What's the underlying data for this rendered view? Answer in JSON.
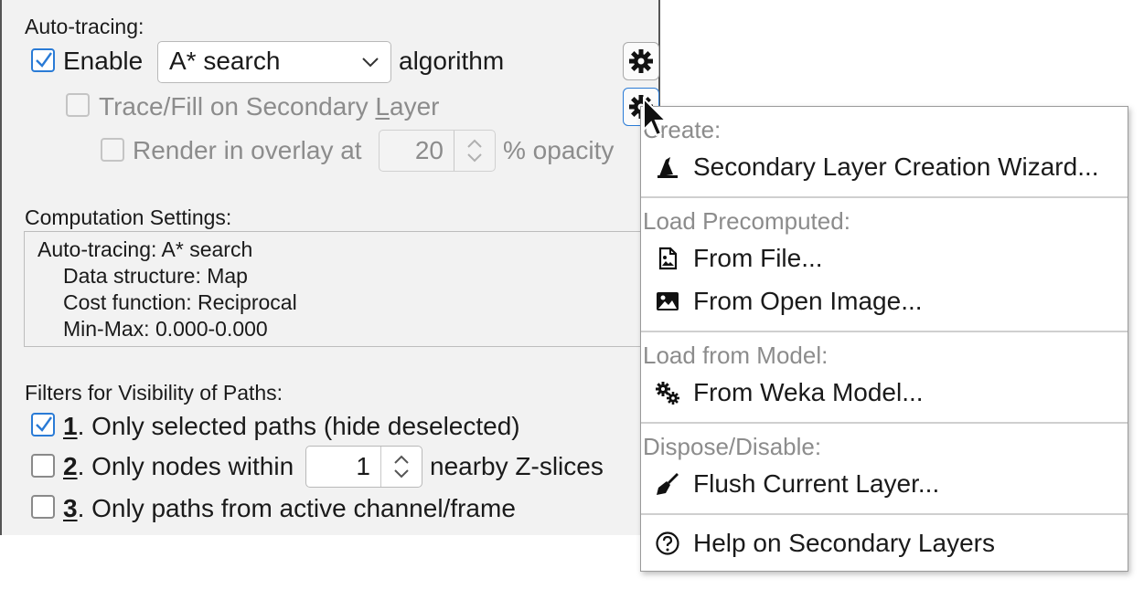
{
  "autotracing": {
    "title": "Auto-tracing:",
    "enable_label": "Enable",
    "enable_checked": true,
    "algorithm_value": "A* search",
    "algorithm_suffix": "algorithm",
    "secondary_layer_label_pre": "Trace/Fill on Secondary ",
    "secondary_layer_label_mnemonic": "L",
    "secondary_layer_label_post": "ayer",
    "secondary_layer_checked": false,
    "overlay_label": "Render in overlay at",
    "overlay_value": "20",
    "overlay_suffix": "% opacity",
    "overlay_checked": false
  },
  "computation": {
    "title": "Computation Settings:",
    "lines": [
      "Auto-tracing: A* search",
      "Data structure: Map",
      "Cost function: Reciprocal",
      "Min-Max: 0.000-0.000"
    ]
  },
  "filters": {
    "title": "Filters for Visibility of Paths:",
    "items": [
      {
        "num": "1",
        "text": ". Only selected paths (hide deselected)",
        "checked": true
      },
      {
        "num": "2",
        "text": ". Only nodes within",
        "value": "1",
        "suffix": "nearby Z-slices",
        "checked": false
      },
      {
        "num": "3",
        "text": ". Only paths from active channel/frame",
        "checked": false
      }
    ]
  },
  "menu": {
    "sections": [
      {
        "header": "Create:",
        "items": [
          {
            "label": "Secondary Layer Creation Wizard...",
            "icon": "wizard-hat-icon"
          }
        ]
      },
      {
        "header": "Load Precomputed:",
        "items": [
          {
            "label": "From File...",
            "icon": "file-image-icon"
          },
          {
            "label": "From Open Image...",
            "icon": "image-icon"
          }
        ]
      },
      {
        "header": "Load from Model:",
        "items": [
          {
            "label": "From Weka Model...",
            "icon": "gears-icon"
          }
        ]
      },
      {
        "header": "Dispose/Disable:",
        "items": [
          {
            "label": "Flush Current Layer...",
            "icon": "broom-icon"
          }
        ]
      },
      {
        "header": "",
        "items": [
          {
            "label": "Help on Secondary Layers",
            "icon": "help-circle-icon"
          }
        ]
      }
    ]
  },
  "colors": {
    "accent": "#2a7bd6",
    "panel_bg": "#f2f2f2",
    "disabled_text": "#8c8c8c"
  }
}
